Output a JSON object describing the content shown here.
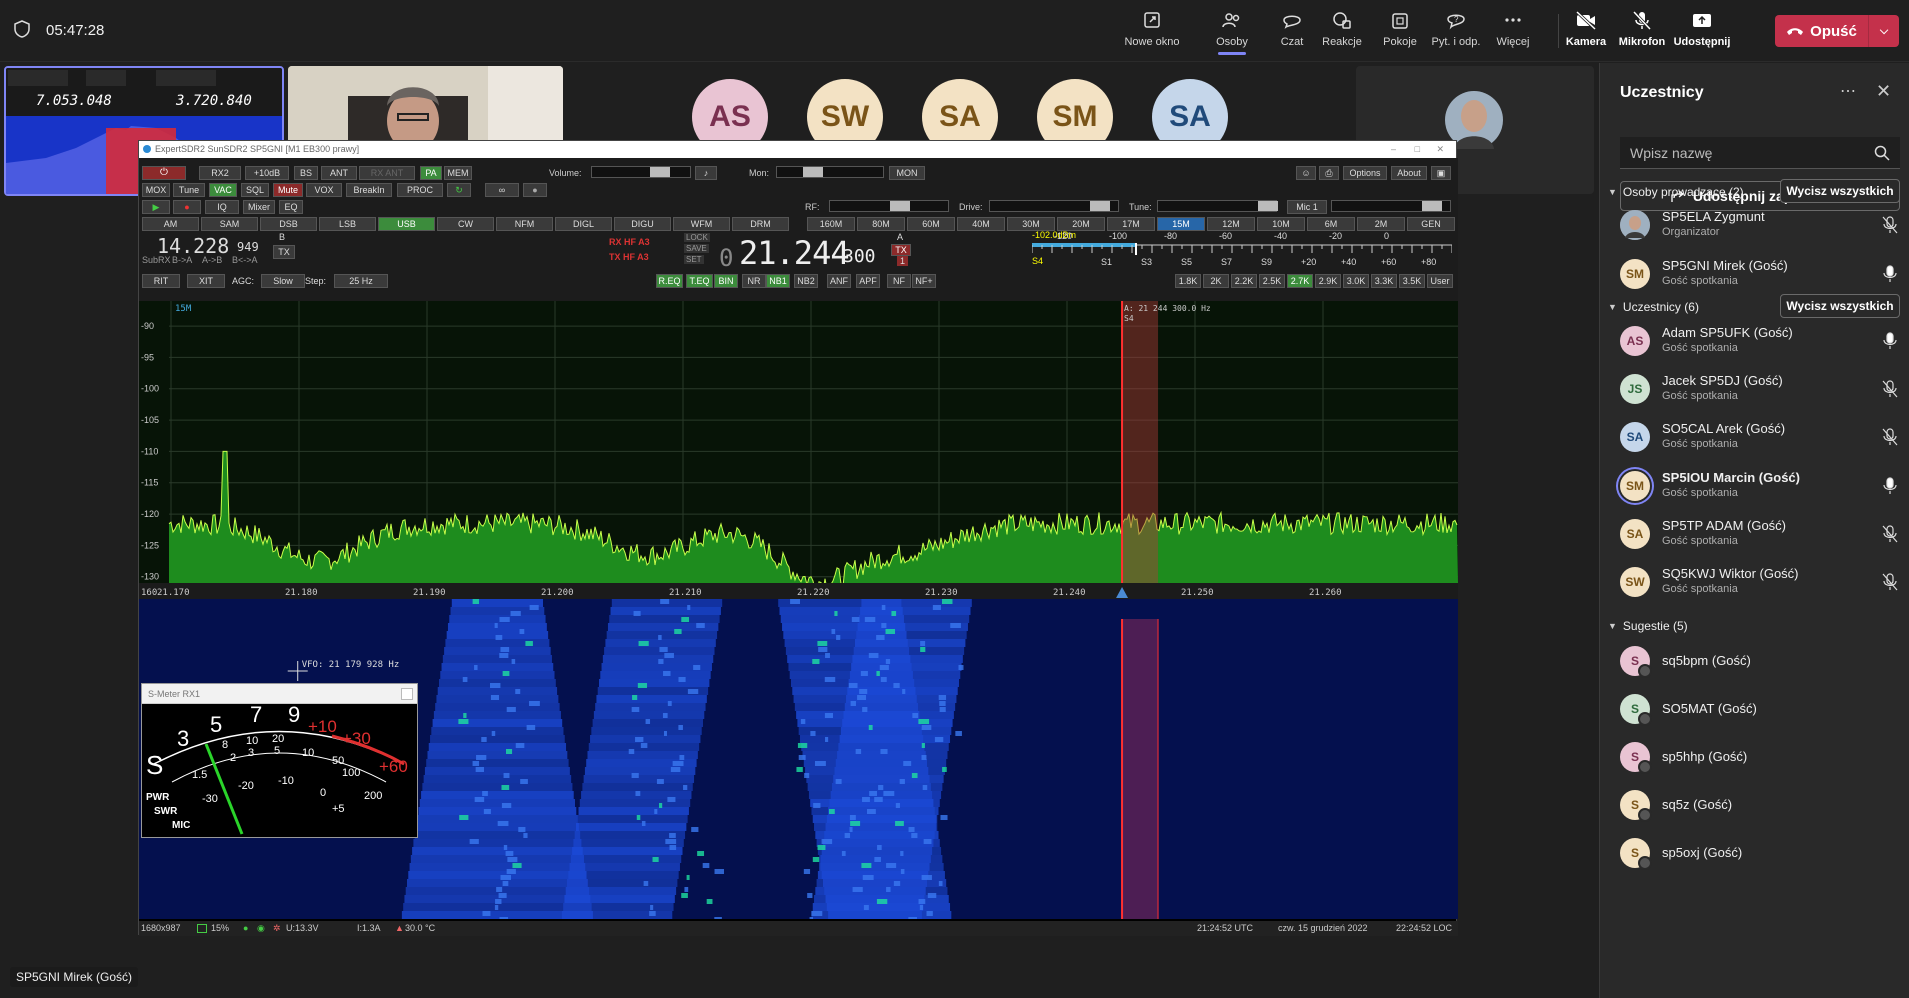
{
  "topbar": {
    "time": "05:47:28",
    "buttons": [
      {
        "label": "Nowe okno",
        "icon": "new-window-icon"
      },
      {
        "label": "Osoby",
        "icon": "people-icon"
      },
      {
        "label": "Czat",
        "icon": "chat-icon"
      },
      {
        "label": "Reakcje",
        "icon": "reactions-icon"
      },
      {
        "label": "Pokoje",
        "icon": "rooms-icon"
      },
      {
        "label": "Pyt. i odp.",
        "icon": "qa-icon"
      },
      {
        "label": "Więcej",
        "icon": "more-icon"
      },
      {
        "label": "Kamera",
        "icon": "camera-off-icon"
      },
      {
        "label": "Mikrofon",
        "icon": "mic-off-icon"
      },
      {
        "label": "Udostępnij",
        "icon": "share-icon"
      }
    ],
    "leave_label": "Opuść"
  },
  "stage": {
    "avatars": [
      {
        "initials": "AS",
        "name": "Adam SP5UFK (...",
        "bg": "#e9c4d3",
        "fg": "#7a3050",
        "muted": false
      },
      {
        "initials": "SW",
        "name": "SQ5KWJ W...",
        "bg": "#f3e2c4",
        "fg": "#7a5418",
        "muted": true
      },
      {
        "initials": "SA",
        "name": "SP5TP ADA...",
        "bg": "#f3e2c4",
        "fg": "#7a5418",
        "muted": true
      },
      {
        "initials": "SM",
        "name": "SP5GNI Mirek (...",
        "bg": "#f3e2c4",
        "fg": "#7a5418",
        "muted": false
      },
      {
        "initials": "SA",
        "name": "SO5CAL Ar...",
        "bg": "#c5d6ea",
        "fg": "#204a7a",
        "muted": true
      }
    ],
    "name_tag": "SP5GNI Mirek (Gość)"
  },
  "sdr": {
    "title": "ExpertSDR2 SunSDR2   SP5GNI   [M1 EB300 prawy]",
    "thumb_freq_a": "7.053.048",
    "thumb_freq_b": "3.720.840",
    "row1": [
      "RX2",
      "+10dB",
      "BS",
      "ANT",
      "RX ANT",
      "PA",
      "MEM"
    ],
    "volume_label": "Volume:",
    "mon_label": "Mon:",
    "mon_btn": "MON",
    "options": "Options",
    "about": "About",
    "row2": [
      "MOX",
      "Tune",
      "VAC",
      "SQL",
      "Mute",
      "VOX",
      "BreakIn",
      "PROC"
    ],
    "row3": [
      "IQ",
      "Mixer",
      "EQ"
    ],
    "rf_label": "RF:",
    "drive_label": "Drive:",
    "tune_label": "Tune:",
    "mic_label": "Mic 1",
    "modes": [
      "AM",
      "SAM",
      "DSB",
      "LSB",
      "USB",
      "CW",
      "NFM",
      "DIGL",
      "DIGU",
      "WFM",
      "DRM"
    ],
    "active_mode": "USB",
    "bands": [
      "160M",
      "80M",
      "60M",
      "40M",
      "30M",
      "20M",
      "17M",
      "15M",
      "12M",
      "10M",
      "6M",
      "2M",
      "GEN"
    ],
    "active_band": "15M",
    "vfo_b": "14.228",
    "vfo_b_small": "949",
    "vfo_b_flags": [
      "B",
      "TX"
    ],
    "vfo_b_btns": [
      "SubRX",
      "B->A",
      "A->B",
      "B<->A"
    ],
    "rx_label": "RX HF  A3",
    "tx_label": "TX HF  A3",
    "lock_btns": [
      "LOCK",
      "SAVE",
      "SET"
    ],
    "vfo_a_prefix": "0",
    "vfo_a": "21.244",
    "vfo_a_small": "300",
    "vfo_a_flags": [
      "A",
      "TX",
      "1"
    ],
    "dbm": "-102.0dBm",
    "s_reading": "S4",
    "scale_top": [
      "-120",
      "-100",
      "-80",
      "-60",
      "-40",
      "-20",
      "0"
    ],
    "scale_bot": [
      "S1",
      "S3",
      "S5",
      "S7",
      "S9",
      "+20",
      "+40",
      "+60",
      "+80"
    ],
    "row5": [
      "RIT",
      "XIT",
      "AGC:",
      "Slow",
      "Step:",
      "25 Hz"
    ],
    "dsp": [
      "R.EQ",
      "T.EQ",
      "BIN",
      "NR",
      "NB1",
      "NB2",
      "ANF",
      "APF",
      "NF",
      "NF+"
    ],
    "filters": [
      "1.8K",
      "2K",
      "2.2K",
      "2.5K",
      "2.7K",
      "2.9K",
      "3.0K",
      "3.3K",
      "3.5K",
      "User"
    ],
    "active_filter": "2.7K",
    "band_tag": "15M",
    "marker_label": "A: 21 244 300.0 Hz",
    "marker_s": "S4",
    "db_ticks": [
      "-90",
      "-95",
      "-100",
      "-105",
      "-110",
      "-115",
      "-120",
      "-125",
      "-130"
    ],
    "freq_ticks": [
      "160",
      "21.170",
      "21.180",
      "21.190",
      "21.200",
      "21.210",
      "21.220",
      "21.230",
      "21.240",
      "21.250",
      "21.260"
    ],
    "vfo_cursor": "VFO: 21 179 928 Hz",
    "smeter_title": "S-Meter RX1",
    "status": {
      "res": "1680x987",
      "cpu": "15%",
      "volt": "U:13.3V",
      "amp": "I:1.3A",
      "temp": "30.0 °C",
      "utc": "21:24:52 UTC",
      "date": "czw. 15 grudzień 2022",
      "loc": "22:24:52 LOC"
    }
  },
  "panel": {
    "title": "Uczestnicy",
    "search_placeholder": "Wpisz nazwę",
    "invite": "Udostępnij zaproszenie",
    "presenters_label": "Osoby prowadzące (2)",
    "mute_all": "Wycisz wszystkich",
    "presenters": [
      {
        "initials": "",
        "name": "SP5ELA Zygmunt",
        "sub": "Organizator",
        "bg": "#8a8a8a",
        "fg": "#fff",
        "mic": "off",
        "photo": true
      },
      {
        "initials": "SM",
        "name": "SP5GNI Mirek (Gość)",
        "sub": "Gość spotkania",
        "bg": "#f3e2c4",
        "fg": "#7a5418",
        "mic": "on"
      }
    ],
    "attendees_label": "Uczestnicy (6)",
    "attendees": [
      {
        "initials": "AS",
        "name": "Adam SP5UFK (Gość)",
        "sub": "Gość spotkania",
        "bg": "#e9c4d3",
        "fg": "#7a3050",
        "mic": "on"
      },
      {
        "initials": "JS",
        "name": "Jacek SP5DJ (Gość)",
        "sub": "Gość spotkania",
        "bg": "#cfe2d2",
        "fg": "#2e6a3c",
        "mic": "off"
      },
      {
        "initials": "SA",
        "name": "SO5CAL Arek (Gość)",
        "sub": "Gość spotkania",
        "bg": "#c5d6ea",
        "fg": "#204a7a",
        "mic": "off"
      },
      {
        "initials": "SM",
        "name": "SP5IOU Marcin (Gość)",
        "sub": "Gość spotkania",
        "bg": "#f3e2c4",
        "fg": "#7a5418",
        "mic": "on",
        "speaking": true
      },
      {
        "initials": "SA",
        "name": "SP5TP ADAM (Gość)",
        "sub": "Gość spotkania",
        "bg": "#f3e2c4",
        "fg": "#7a5418",
        "mic": "off"
      },
      {
        "initials": "SW",
        "name": "SQ5KWJ Wiktor (Gość)",
        "sub": "Gość spotkania",
        "bg": "#f3e2c4",
        "fg": "#7a5418",
        "mic": "off"
      }
    ],
    "suggestions_label": "Sugestie (5)",
    "suggestions": [
      {
        "initials": "S",
        "name": "sq5bpm (Gość)",
        "bg": "#e9c4d3",
        "fg": "#7a3050"
      },
      {
        "initials": "S",
        "name": "SO5MAT (Gość)",
        "bg": "#cfe2d2",
        "fg": "#2e6a3c"
      },
      {
        "initials": "S",
        "name": "sp5hhp (Gość)",
        "bg": "#e9c4d3",
        "fg": "#7a3050"
      },
      {
        "initials": "S",
        "name": "sq5z (Gość)",
        "bg": "#f3e2c4",
        "fg": "#7a5418"
      },
      {
        "initials": "S",
        "name": "sp5oxj (Gość)",
        "bg": "#f3e2c4",
        "fg": "#7a5418"
      }
    ]
  }
}
